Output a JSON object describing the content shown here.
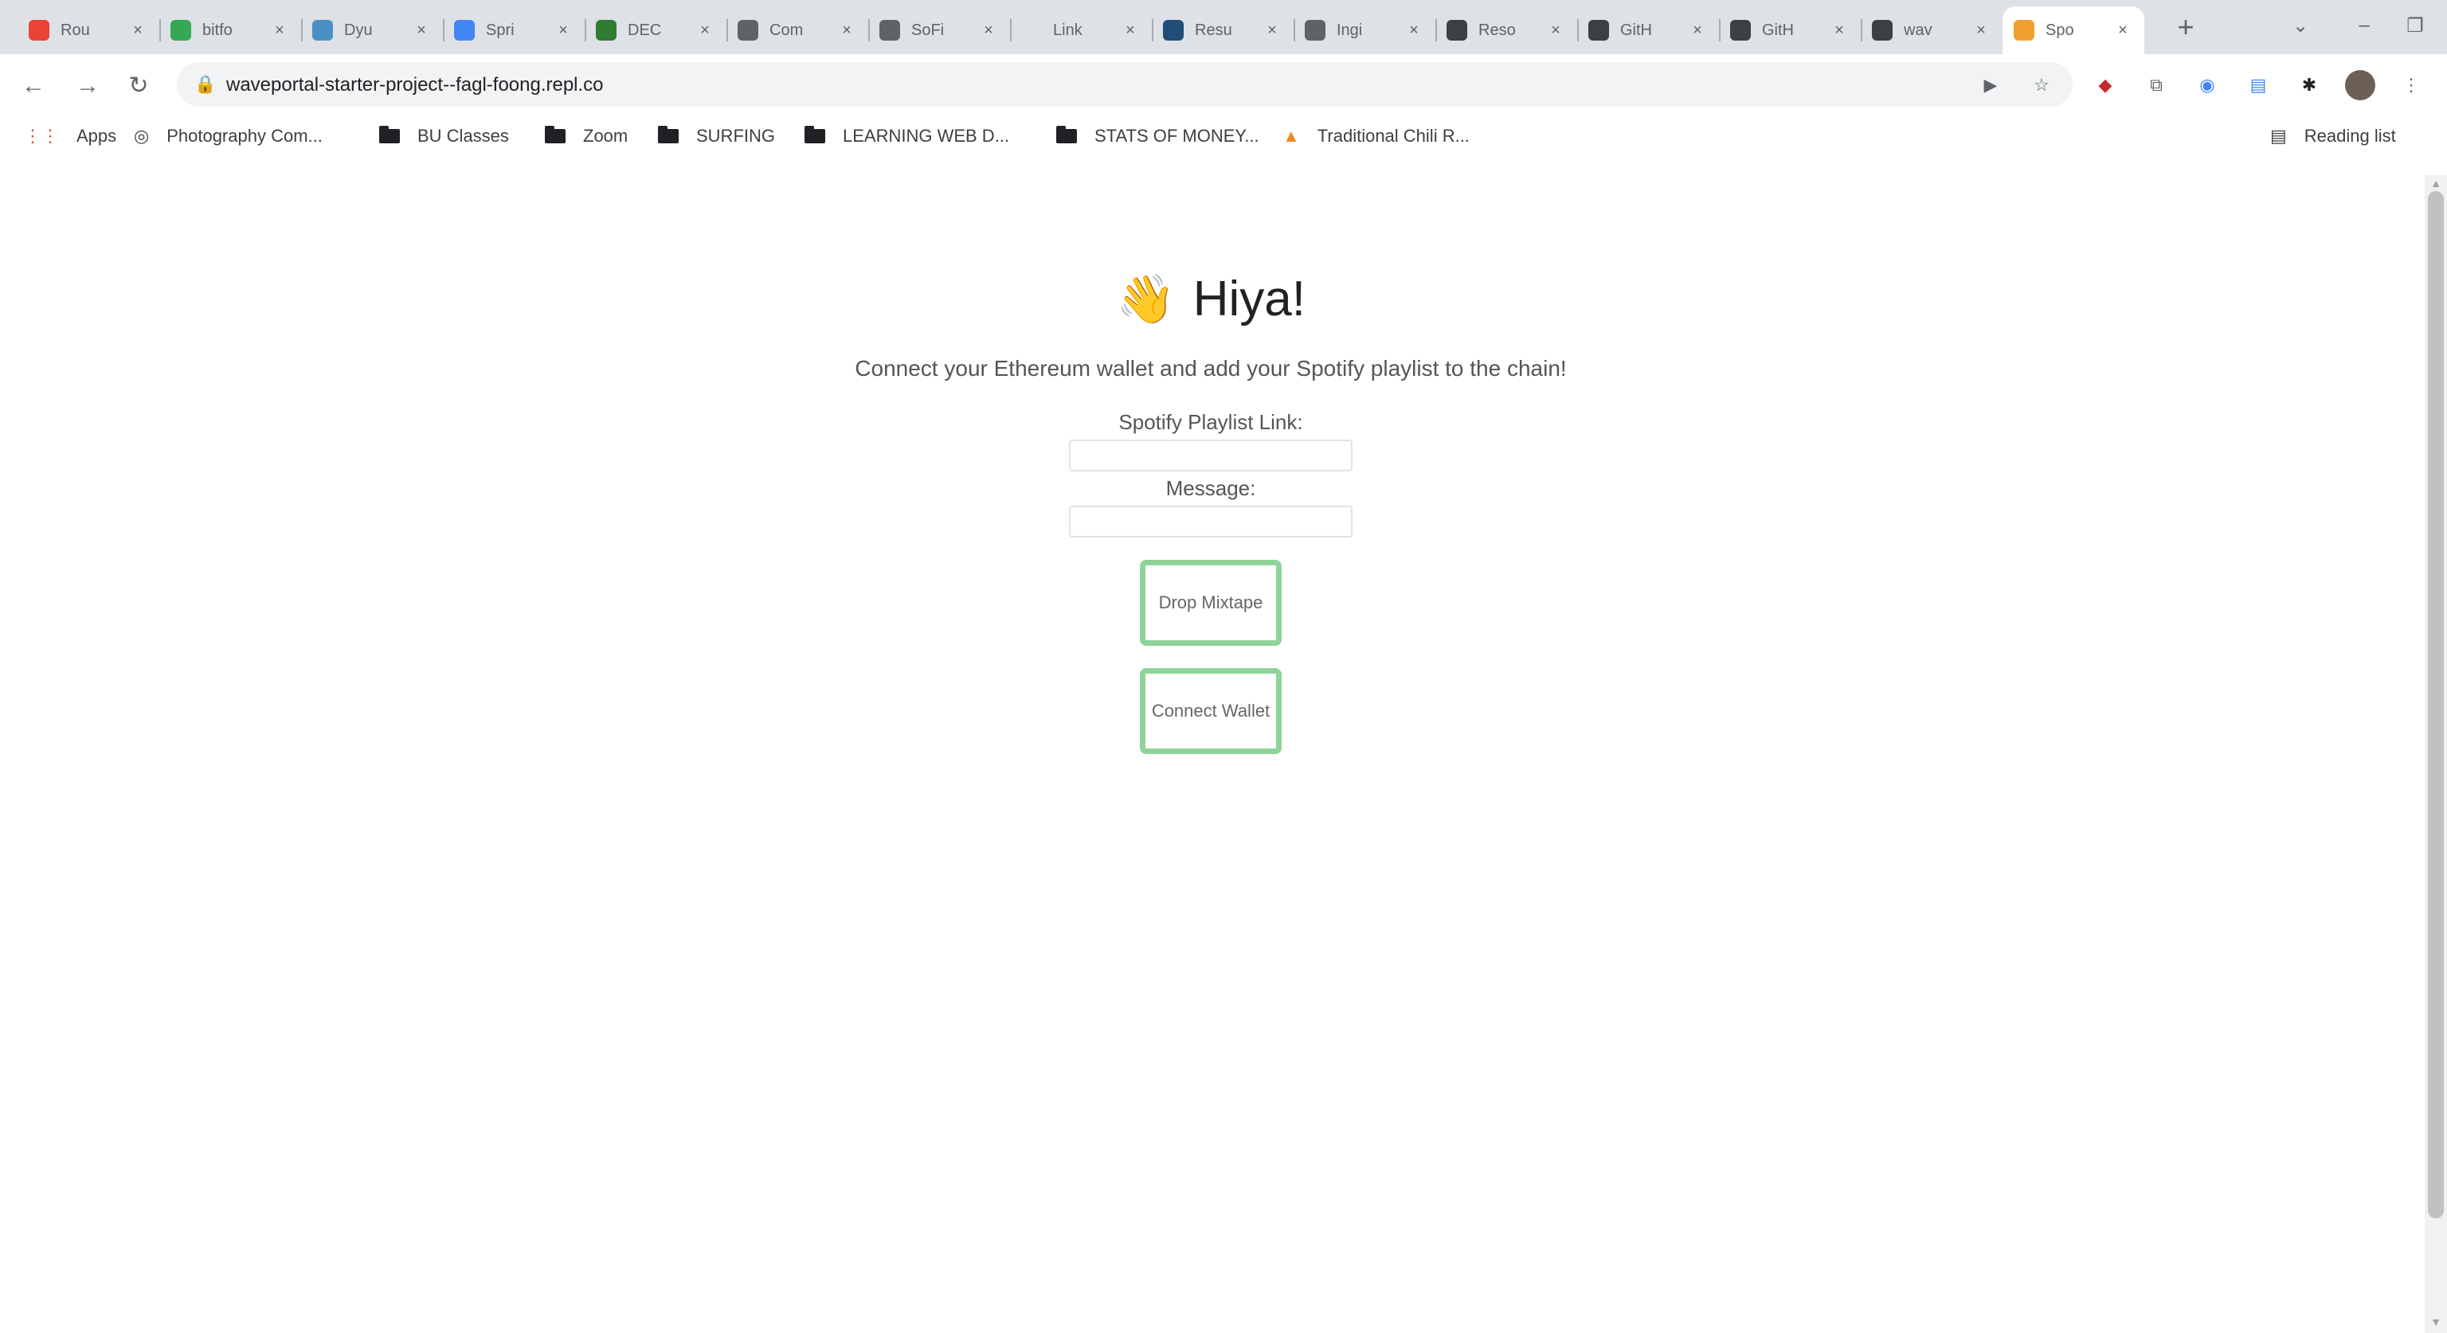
{
  "browser": {
    "tabs": [
      {
        "title": "Rou",
        "favicon_color": "#ea4335"
      },
      {
        "title": "bitfo",
        "favicon_color": "#34a853"
      },
      {
        "title": "Dyu",
        "favicon_color": "#4a90c4"
      },
      {
        "title": "Spri",
        "favicon_color": "#4285f4"
      },
      {
        "title": "DEC",
        "favicon_color": "#2e7d32"
      },
      {
        "title": "Com",
        "favicon_color": "#5f6368"
      },
      {
        "title": "SoFi",
        "favicon_color": "#5f6368"
      },
      {
        "title": "Link",
        "favicon_color": "#dee1e6"
      },
      {
        "title": "Resu",
        "favicon_color": "#1f4e79"
      },
      {
        "title": "Ingi",
        "favicon_color": "#5f6368"
      },
      {
        "title": "Reso",
        "favicon_color": "#3c4043"
      },
      {
        "title": "GitH",
        "favicon_color": "#3c4043"
      },
      {
        "title": "GitH",
        "favicon_color": "#3c4043"
      },
      {
        "title": "wav",
        "favicon_color": "#3c4043"
      },
      {
        "title": "Spo",
        "favicon_color": "#f0a030",
        "active": true
      }
    ],
    "new_tab_icon": "+",
    "url": "waveportal-starter-project--fagl-foong.repl.co",
    "bookmarks": [
      {
        "label": "Apps",
        "icon": "apps-grid-icon"
      },
      {
        "label": "Photography Com...",
        "icon": "camera-icon"
      },
      {
        "label": "BU Classes",
        "icon": "folder-icon"
      },
      {
        "label": "Zoom",
        "icon": "folder-icon"
      },
      {
        "label": "SURFING",
        "icon": "folder-icon"
      },
      {
        "label": "LEARNING WEB D...",
        "icon": "folder-icon"
      },
      {
        "label": "STATS OF MONEY...",
        "icon": "folder-icon"
      },
      {
        "label": "Traditional Chili R...",
        "icon": "image-icon"
      }
    ],
    "reading_list": "Reading list"
  },
  "page": {
    "title": "Hiya!",
    "title_icon": "waving-hand-icon",
    "subtitle": "Connect your Ethereum wallet and add your Spotify playlist to the chain!",
    "playlist_label": "Spotify Playlist Link:",
    "message_label": "Message:",
    "playlist_value": "",
    "message_value": "",
    "drop_button": "Drop Mixtape",
    "connect_button": "Connect Wallet"
  },
  "colors": {
    "button_border": "#8fd39a",
    "tab_strip": "#dee1e6",
    "omnibox": "#f1f3f4"
  }
}
